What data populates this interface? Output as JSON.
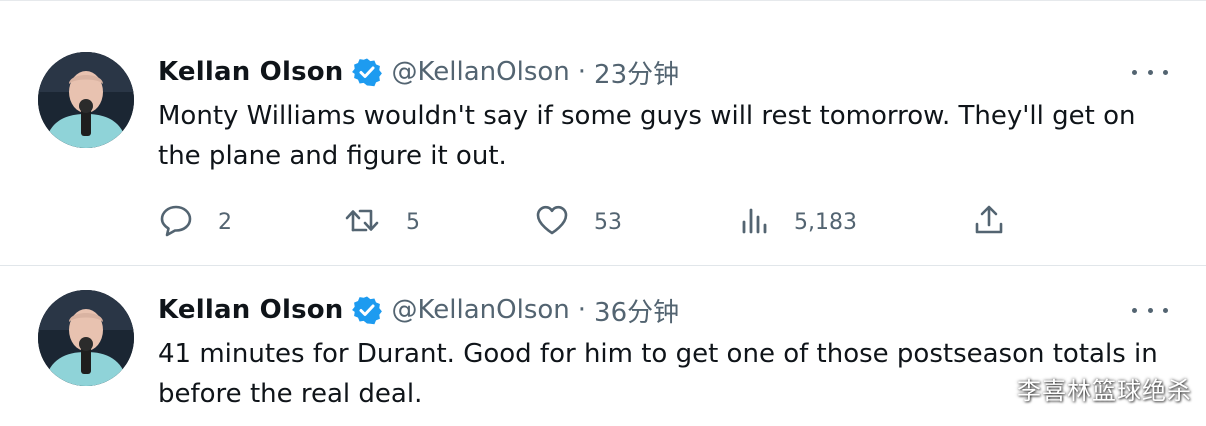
{
  "tweets": [
    {
      "author_name": "Kellan Olson",
      "handle": "@KellanOlson",
      "separator": "·",
      "time": "23分钟",
      "text": "Monty Williams wouldn't say if some guys will rest tomorrow. They'll get on the plane and figure it out.",
      "stats": {
        "replies": "2",
        "retweets": "5",
        "likes": "53",
        "views": "5,183"
      }
    },
    {
      "author_name": "Kellan Olson",
      "handle": "@KellanOlson",
      "separator": "·",
      "time": "36分钟",
      "text": "41 minutes for Durant. Good for him to get one of those postseason totals in before the real deal."
    }
  ],
  "icons": {
    "verified": "verified-badge-icon",
    "more": "more-options-icon",
    "reply": "reply-icon",
    "retweet": "retweet-icon",
    "like": "like-heart-icon",
    "views": "views-chart-icon",
    "share": "share-icon"
  },
  "colors": {
    "verified_blue": "#1d9bf0",
    "muted_text": "#536471",
    "text": "#0f1419"
  },
  "watermark": "李喜林篮球绝杀"
}
